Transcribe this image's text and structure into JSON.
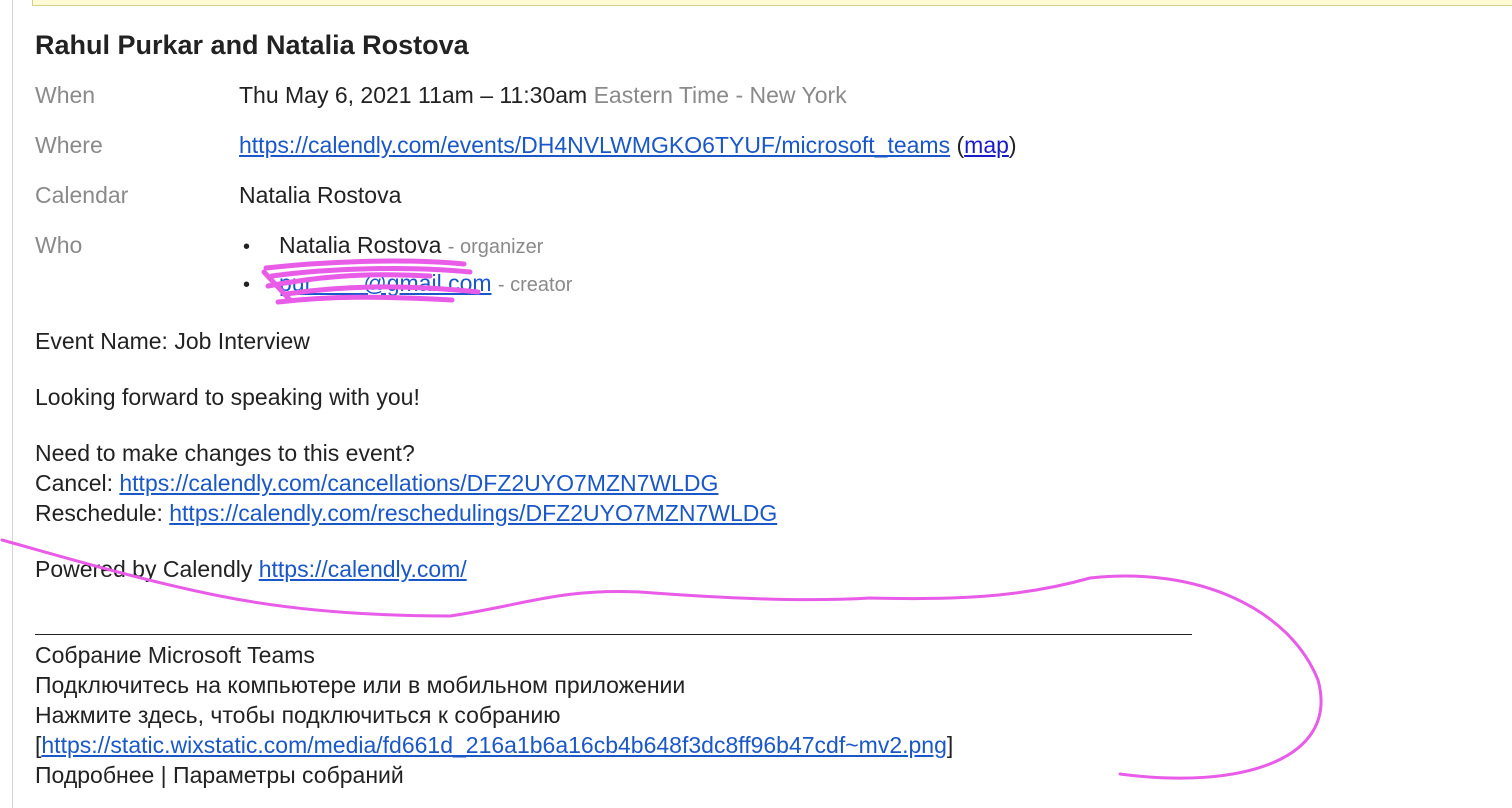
{
  "event": {
    "title": "Rahul Purkar and Natalia Rostova",
    "when_label": "When",
    "when_value": "Thu May 6, 2021 11am – 11:30am",
    "timezone": "Eastern Time - New York",
    "where_label": "Where",
    "where_url": "https://calendly.com/events/DH4NVLWMGKO6TYUF/microsoft_teams",
    "open_paren": "(",
    "map_label": "map",
    "close_paren": ")",
    "calendar_label": "Calendar",
    "calendar_value": "Natalia Rostova",
    "who_label": "Who",
    "attendees": [
      {
        "name": "Natalia Rostova",
        "role": "- organizer"
      },
      {
        "email_visible": "pur        @gmail.com",
        "role": "- creator"
      }
    ]
  },
  "description": {
    "event_name": "Event Name: Job Interview",
    "greeting": "Looking forward to speaking with you!",
    "changes_prompt": "Need to make changes to this event?",
    "cancel_label": "Cancel:",
    "cancel_url": "https://calendly.com/cancellations/DFZ2UYO7MZN7WLDG",
    "reschedule_label": "Reschedule:",
    "reschedule_url": "https://calendly.com/reschedulings/DFZ2UYO7MZN7WLDG",
    "powered_label": "Powered by Calendly",
    "powered_url": "https://calendly.com/"
  },
  "teams": {
    "meeting_title": "Собрание Microsoft Teams",
    "join_hint": "Подключитесь на компьютере или в мобильном приложении",
    "click_here": "Нажмите здесь, чтобы подключиться к собранию",
    "bracket_open": "[",
    "image_url": "https://static.wixstatic.com/media/fd661d_216a1b6a16cb4b648f3dc8ff96b47cdf~mv2.png",
    "bracket_close": "]",
    "footer": "Подробнее | Параметры собраний"
  },
  "colors": {
    "link": "#1a57c9",
    "muted": "#8a8a8a",
    "annotation": "#e85ce8",
    "notice_bg": "#fffcd6"
  }
}
